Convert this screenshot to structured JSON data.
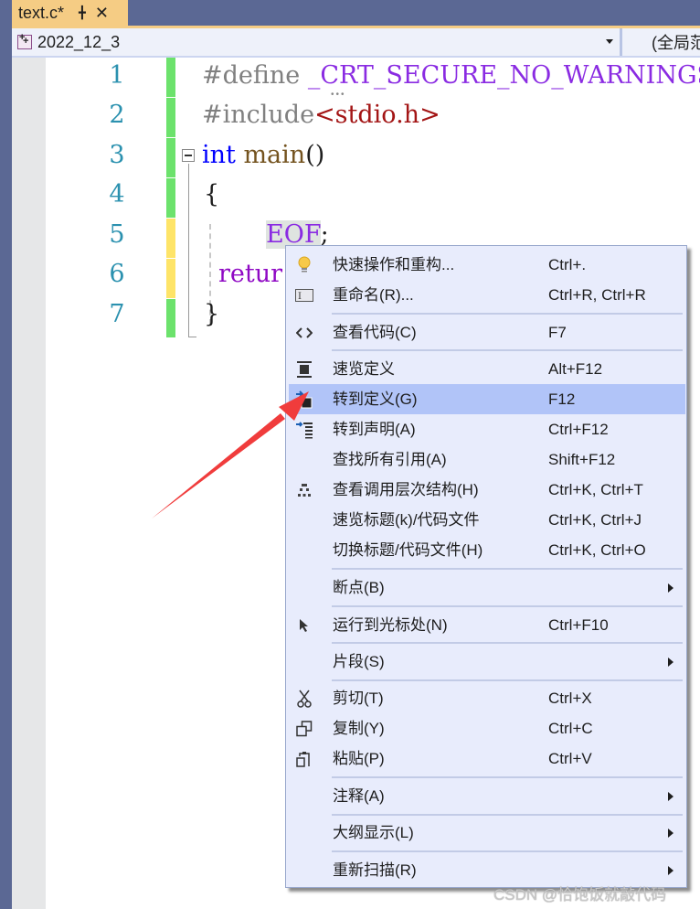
{
  "tab": {
    "title": "text.c*",
    "pin_icon": "pin-icon",
    "close_icon": "close-icon"
  },
  "navbar": {
    "project": "2022_12_3",
    "scope": "(全局范",
    "project_icon": "project-icon",
    "dropdown_icon": "chevron-down-icon"
  },
  "editor": {
    "line_numbers": [
      "1",
      "2",
      "3",
      "4",
      "5",
      "6",
      "7"
    ],
    "change_markers": [
      "saved",
      "saved",
      "saved",
      "saved",
      "unsaved",
      "unsaved",
      "saved"
    ],
    "colors": {
      "saved": "#6ce26c",
      "unsaved": "#fee468",
      "line_number": "#2b91af"
    },
    "lines": {
      "l1_pre": "#define ",
      "l1_macro": "_CRT_SECURE_NO_WARNINGS",
      "l2_pre": "#include",
      "l2_str": "<stdio.h>",
      "l3_kw": "int",
      "l3_fn": " main",
      "l3_rest": "()",
      "l4": "{",
      "l5_indent": "  ",
      "l5_sym": "EOF",
      "l5_rest": ";",
      "l6": "retur",
      "l7": "}"
    }
  },
  "context_menu": {
    "items": [
      {
        "label": "快速操作和重构...",
        "shortcut": "Ctrl+.",
        "icon": "lightbulb-icon"
      },
      {
        "label": "重命名(R)...",
        "shortcut": "Ctrl+R, Ctrl+R",
        "icon": "rename-icon"
      },
      {
        "label": "查看代码(C)",
        "shortcut": "F7",
        "icon": "code-icon"
      },
      {
        "label": "速览定义",
        "shortcut": "Alt+F12",
        "icon": "peek-definition-icon"
      },
      {
        "label": "转到定义(G)",
        "shortcut": "F12",
        "icon": "go-to-definition-icon",
        "highlighted": true
      },
      {
        "label": "转到声明(A)",
        "shortcut": "Ctrl+F12",
        "icon": "go-to-declaration-icon"
      },
      {
        "label": "查找所有引用(A)",
        "shortcut": "Shift+F12",
        "icon": ""
      },
      {
        "label": "查看调用层次结构(H)",
        "shortcut": "Ctrl+K, Ctrl+T",
        "icon": "call-hierarchy-icon"
      },
      {
        "label": "速览标题(k)/代码文件",
        "shortcut": "Ctrl+K, Ctrl+J",
        "icon": ""
      },
      {
        "label": "切换标题/代码文件(H)",
        "shortcut": "Ctrl+K, Ctrl+O",
        "icon": ""
      },
      {
        "label": "断点(B)",
        "shortcut": "",
        "icon": "",
        "submenu": true
      },
      {
        "label": "运行到光标处(N)",
        "shortcut": "Ctrl+F10",
        "icon": "cursor-icon"
      },
      {
        "label": "片段(S)",
        "shortcut": "",
        "icon": "",
        "submenu": true
      },
      {
        "label": "剪切(T)",
        "shortcut": "Ctrl+X",
        "icon": "scissors-icon"
      },
      {
        "label": "复制(Y)",
        "shortcut": "Ctrl+C",
        "icon": "copy-icon"
      },
      {
        "label": "粘贴(P)",
        "shortcut": "Ctrl+V",
        "icon": "paste-icon"
      },
      {
        "label": "注释(A)",
        "shortcut": "",
        "icon": "",
        "submenu": true
      },
      {
        "label": "大纲显示(L)",
        "shortcut": "",
        "icon": "",
        "submenu": true
      },
      {
        "label": "重新扫描(R)",
        "shortcut": "",
        "icon": "",
        "submenu": true
      }
    ],
    "highlight_color": "#b1c4f8"
  },
  "annotation": {
    "arrow_color": "#f03c3c"
  },
  "watermark": "CSDN @恰饱饭就敲代码"
}
